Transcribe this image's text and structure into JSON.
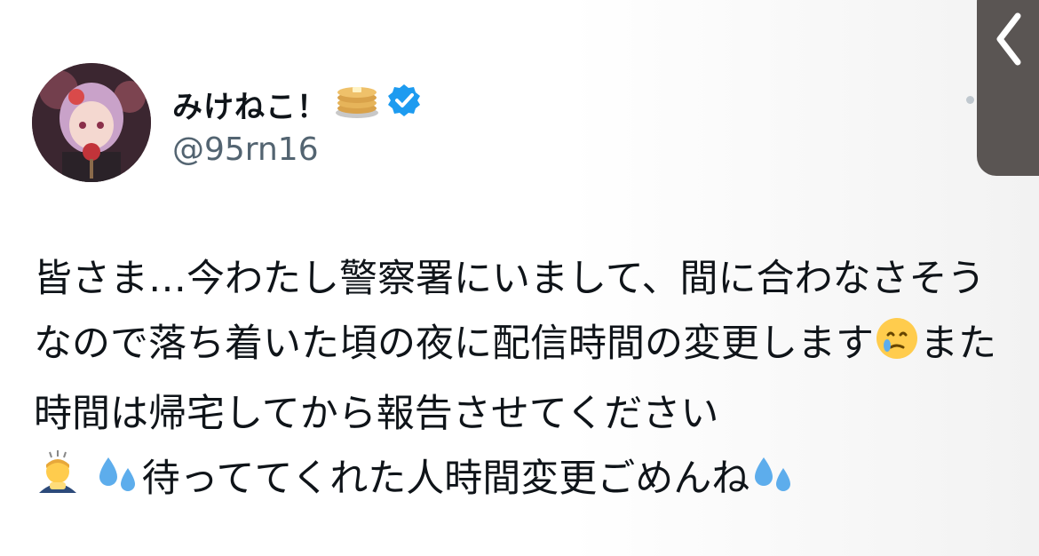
{
  "profile": {
    "display_name": "みけねこ！",
    "handle": "@95rn16",
    "name_emoji_icon": "pancakes-icon",
    "verified_icon": "verified-badge-icon"
  },
  "colors": {
    "verified_blue": "#1d9bf0",
    "handle_gray": "#536471",
    "text": "#0f1419",
    "panel": "#5a5553"
  },
  "tweet": {
    "segments": {
      "s1": "皆さま…今わたし警察署にいまして、間に合わなさそうなので落ち着いた頃の夜に配信時間の変更します",
      "s2": "また時間は帰宅してから報告させてください",
      "s3": "待っててくれた人時間変更ごめんね"
    },
    "emoji_icons": [
      "face-holding-back-tears-icon",
      "person-bowing-icon",
      "sweat-droplets-icon",
      "sweat-droplets-icon"
    ]
  }
}
